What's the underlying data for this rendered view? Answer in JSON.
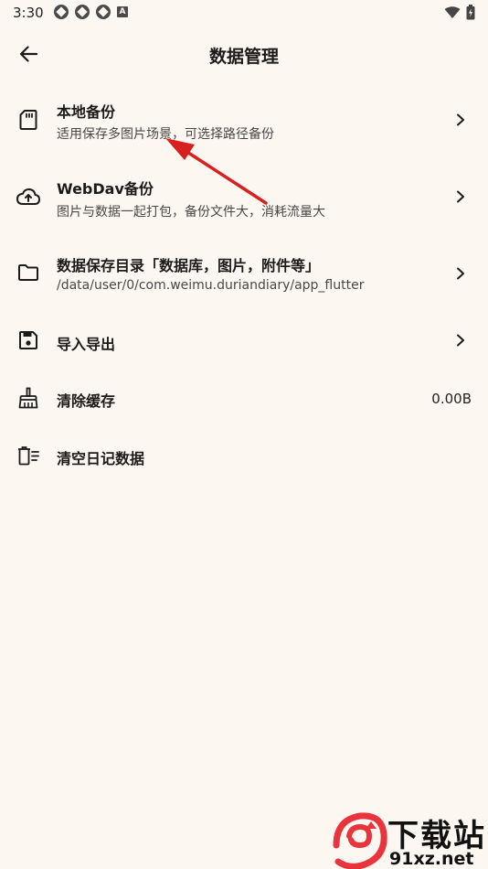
{
  "status_bar": {
    "time": "3:30",
    "notification_badge": "A"
  },
  "header": {
    "title": "数据管理"
  },
  "items": [
    {
      "title": "本地备份",
      "subtitle": "适用保存多图片场景，可选择路径备份",
      "icon": "sd-card-icon"
    },
    {
      "title": "WebDav备份",
      "subtitle": "图片与数据一起打包，备份文件大，消耗流量大",
      "icon": "cloud-upload-icon"
    },
    {
      "title": "数据保存目录「数据库，图片，附件等」",
      "subtitle": "/data/user/0/com.weimu.duriandiary/app_flutter",
      "icon": "folder-icon"
    },
    {
      "title": "导入导出",
      "icon": "save-icon"
    },
    {
      "title": "清除缓存",
      "value": "0.00B",
      "icon": "broom-icon"
    },
    {
      "title": "清空日记数据",
      "icon": "delete-list-icon"
    }
  ],
  "colors": {
    "background": "#fdf7f2",
    "annotation_arrow": "#d8201f",
    "watermark_red": "#e8343a"
  },
  "watermark": {
    "line1": "下载站",
    "line2": "91xz.net"
  }
}
